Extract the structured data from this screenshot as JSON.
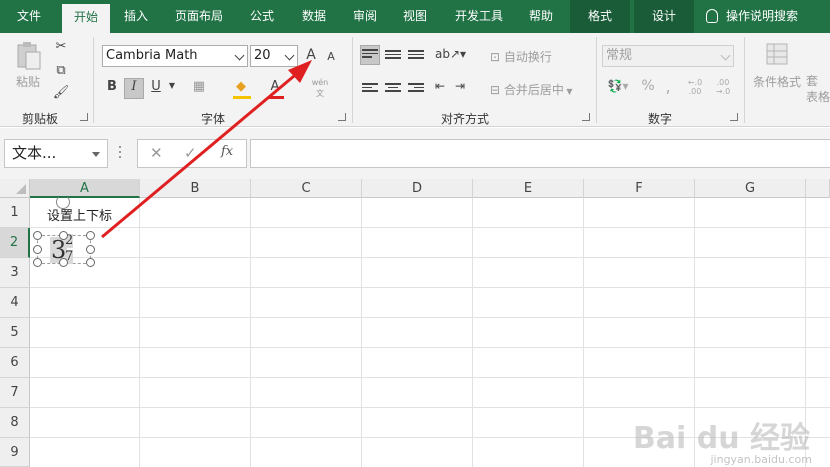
{
  "tabs": [
    {
      "label": "文件"
    },
    {
      "label": "开始"
    },
    {
      "label": "插入"
    },
    {
      "label": "页面布局"
    },
    {
      "label": "公式"
    },
    {
      "label": "数据"
    },
    {
      "label": "审阅"
    },
    {
      "label": "视图"
    },
    {
      "label": "开发工具"
    },
    {
      "label": "帮助"
    },
    {
      "label": "格式"
    },
    {
      "label": "设计"
    }
  ],
  "search_label": "操作说明搜索",
  "clipboard": {
    "paste_label": "粘贴",
    "group_label": "剪贴板"
  },
  "font": {
    "name": "Cambria Math",
    "size": "20",
    "group_label": "字体",
    "grow_label": "A",
    "shrink_label": "A",
    "bold": "B",
    "italic": "I",
    "underline": "U",
    "color_letter": "A",
    "phonetic": "wén 文"
  },
  "alignment": {
    "wrap_label": "自动换行",
    "merge_label": "合并后居中",
    "group_label": "对齐方式"
  },
  "number": {
    "format": "常规",
    "percent": "%",
    "comma": ",",
    "inc_decimal": "←.0 .00",
    "dec_decimal": ".00 →.0",
    "group_label": "数字"
  },
  "styles": {
    "cond_format_label": "条件格式",
    "table_label": "套 表格"
  },
  "formula_bar": {
    "name_box": "文本...",
    "cancel": "✕",
    "enter": "✓",
    "fx": "fx"
  },
  "columns": [
    "A",
    "B",
    "C",
    "D",
    "E",
    "F",
    "G"
  ],
  "rows": [
    "1",
    "2",
    "3",
    "4",
    "5",
    "6",
    "7",
    "8",
    "9"
  ],
  "cells": {
    "a1": "设置上下标"
  },
  "equation": {
    "base": "3",
    "sup": "2",
    "sub": "7"
  },
  "watermark": {
    "main": "Bai du 经验",
    "sub": "jingyan.baidu.com"
  },
  "colors": {
    "accent": "#217346",
    "arrow": "#e02020"
  }
}
